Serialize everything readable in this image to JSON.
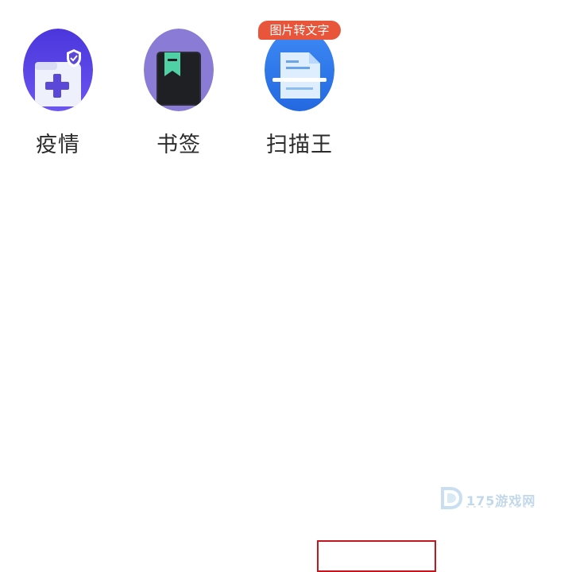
{
  "apps": [
    {
      "id": "epidemic",
      "label": "疫情",
      "icon": "medical-folder-shield-icon"
    },
    {
      "id": "bookmark",
      "label": "书签",
      "icon": "bookmark-book-icon"
    },
    {
      "id": "scanner",
      "label": "扫描王",
      "icon": "document-scan-icon",
      "badge": "图片转文字"
    }
  ],
  "watermark": {
    "text": "175游戏网"
  },
  "colors": {
    "epidemic_bg": "#5a46e8",
    "bookmark_bg": "#8a7bd6",
    "scanner_bg": "#2f7ff0",
    "badge_bg": "#e8553a",
    "highlight_border": "#c4161c"
  }
}
